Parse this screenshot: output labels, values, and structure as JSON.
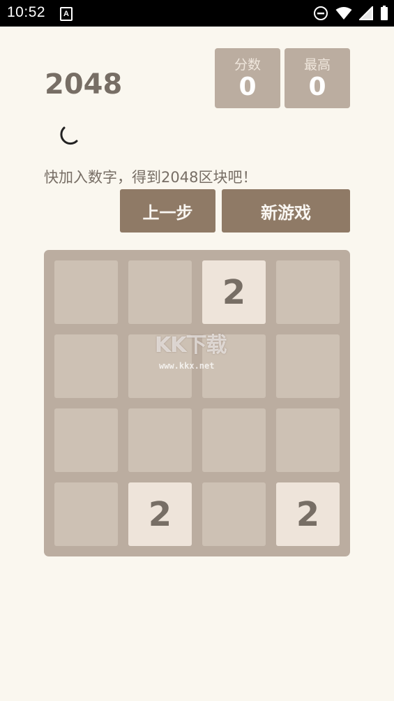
{
  "status_bar": {
    "time": "10:52",
    "a_badge": "A",
    "icons": [
      "dnd-icon",
      "wifi-icon",
      "signal-icon",
      "battery-icon"
    ]
  },
  "game": {
    "title": "2048",
    "score_label": "分数",
    "score_value": "0",
    "best_label": "最高",
    "best_value": "0",
    "tagline": "快加入数字，得到2048区块吧！",
    "undo_label": "上一步",
    "new_game_label": "新游戏",
    "theme_icon": "moon-icon"
  },
  "board": {
    "rows": [
      [
        "",
        "",
        "2",
        ""
      ],
      [
        "",
        "",
        "",
        ""
      ],
      [
        "",
        "",
        "",
        ""
      ],
      [
        "",
        "2",
        "",
        "2"
      ]
    ]
  },
  "watermark": {
    "logo": "KK下载",
    "url": "www.kkx.net"
  },
  "colors": {
    "background": "#faf7ef",
    "board": "#bbada0",
    "empty_cell": "#cdc1b4",
    "tile_2": "#eee4da",
    "button": "#8f7a66",
    "text": "#776e65"
  }
}
